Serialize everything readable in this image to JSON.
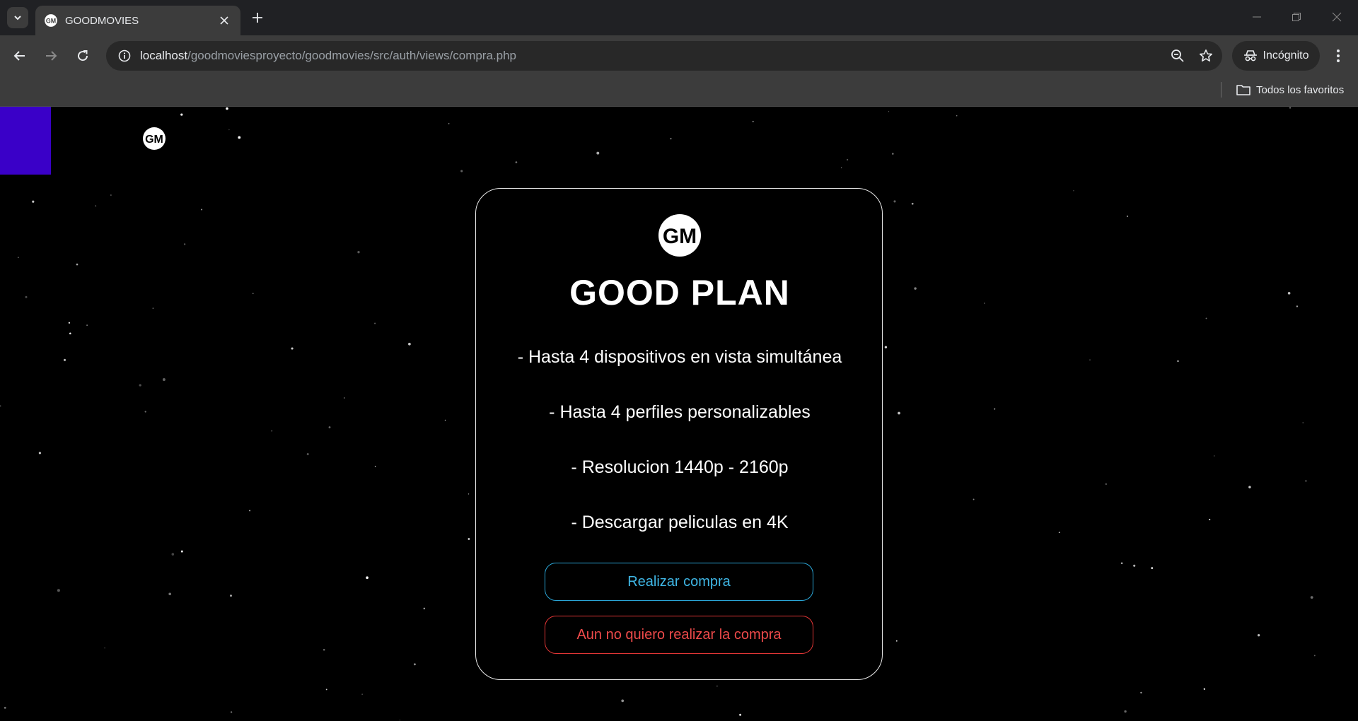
{
  "browser": {
    "tab": {
      "title": "GOODMOVIES",
      "favicon": "gm-logo-icon"
    },
    "url": {
      "host": "localhost",
      "path": "/goodmoviesproyecto/goodmovies/src/auth/views/compra.php"
    },
    "incognito_label": "Incógnito",
    "bookmarks": {
      "all_label": "Todos los favoritos"
    }
  },
  "page": {
    "accent_color": "#3a00c8",
    "plan": {
      "title": "GOOD PLAN",
      "features": [
        "- Hasta 4 dispositivos en vista simultánea",
        "- Hasta 4 perfiles personalizables",
        "- Resolucion 1440p - 2160p",
        "- Descargar peliculas en 4K"
      ]
    },
    "buttons": {
      "buy": "Realizar compra",
      "cancel": "Aun no quiero realizar la compra"
    },
    "colors": {
      "buy": "#3fb7e6",
      "cancel": "#ee4a4a"
    }
  }
}
